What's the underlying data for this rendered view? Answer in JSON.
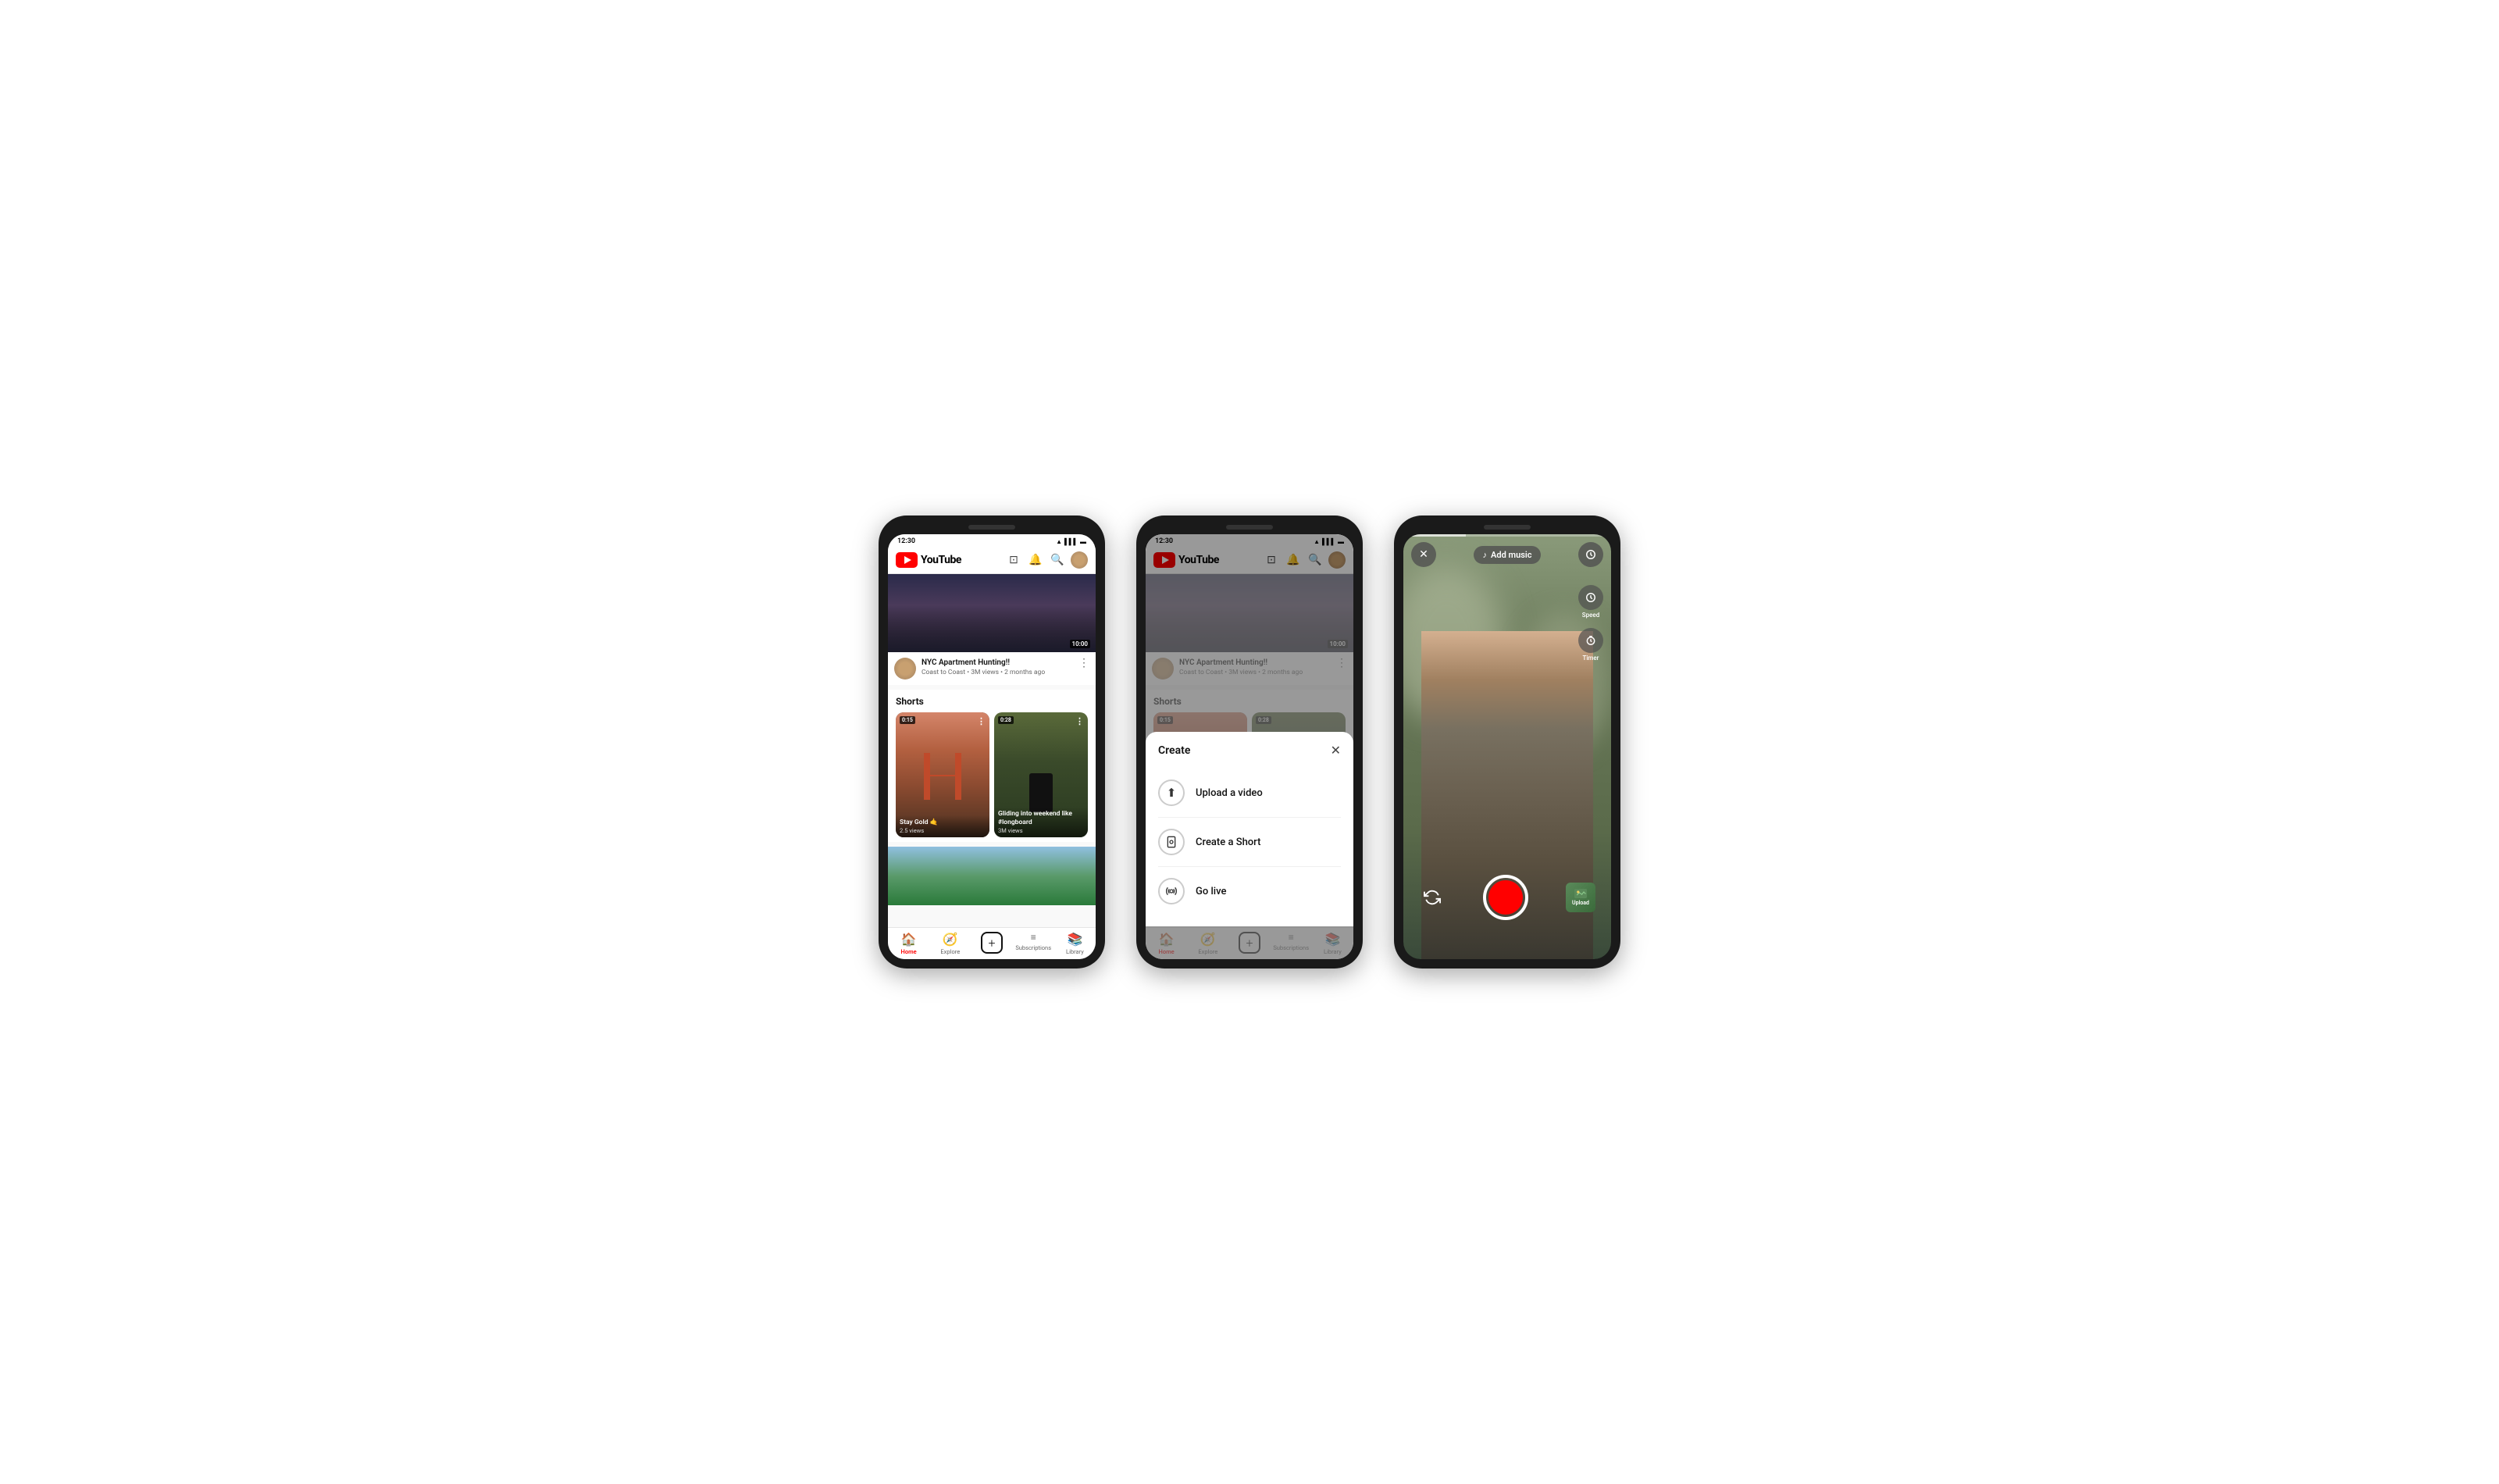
{
  "phones": [
    {
      "id": "phone1",
      "statusBar": {
        "time": "12:30",
        "icons": [
          "wifi",
          "signal",
          "battery"
        ]
      },
      "header": {
        "logoText": "YouTube",
        "icons": [
          "cast",
          "bell",
          "search",
          "avatar"
        ]
      },
      "videoBanner": {
        "duration": "10:00"
      },
      "videoInfo": {
        "title": "NYC Apartment Hunting!!",
        "channel": "Coast to Coast",
        "views": "3M views",
        "ago": "2 months ago"
      },
      "shortsSection": {
        "title": "Shorts",
        "cards": [
          {
            "duration": "0:15",
            "title": "Stay Gold 🤙",
            "views": "2.5 views"
          },
          {
            "duration": "0:28",
            "title": "Gliding into weekend like #longboard",
            "views": "3M views"
          }
        ]
      },
      "bottomNav": {
        "items": [
          {
            "icon": "🏠",
            "label": "Home",
            "active": true
          },
          {
            "icon": "🧭",
            "label": "Explore",
            "active": false
          },
          {
            "icon": "+",
            "label": "",
            "active": false,
            "isPlus": true
          },
          {
            "icon": "≡",
            "label": "Subscriptions",
            "active": false
          },
          {
            "icon": "📚",
            "label": "Library",
            "active": false
          }
        ]
      }
    },
    {
      "id": "phone2",
      "hasModal": true,
      "statusBar": {
        "time": "12:30"
      },
      "header": {
        "logoText": "YouTube"
      },
      "videoBanner": {
        "duration": "10:00"
      },
      "videoInfo": {
        "title": "NYC Apartment Hunting!!",
        "channel": "Coast to Coast",
        "views": "3M views",
        "ago": "2 months ago"
      },
      "createSheet": {
        "title": "Create",
        "items": [
          {
            "icon": "⬆",
            "label": "Upload a video"
          },
          {
            "icon": "📷",
            "label": "Create a Short"
          },
          {
            "icon": "📡",
            "label": "Go live"
          }
        ]
      }
    },
    {
      "id": "phone3",
      "isCamera": true,
      "topBar": {
        "closeIcon": "✕",
        "addMusicLabel": "Add music",
        "musicIcon": "♪",
        "speedIcon": "⏱",
        "timerIcon": "⏱"
      },
      "rightControls": [
        {
          "icon": "⏱",
          "label": "Speed"
        },
        {
          "icon": "⏱",
          "label": "Timer"
        }
      ],
      "bottomBar": {
        "flipIcon": "↺",
        "uploadLabel": "Upload"
      }
    }
  ]
}
